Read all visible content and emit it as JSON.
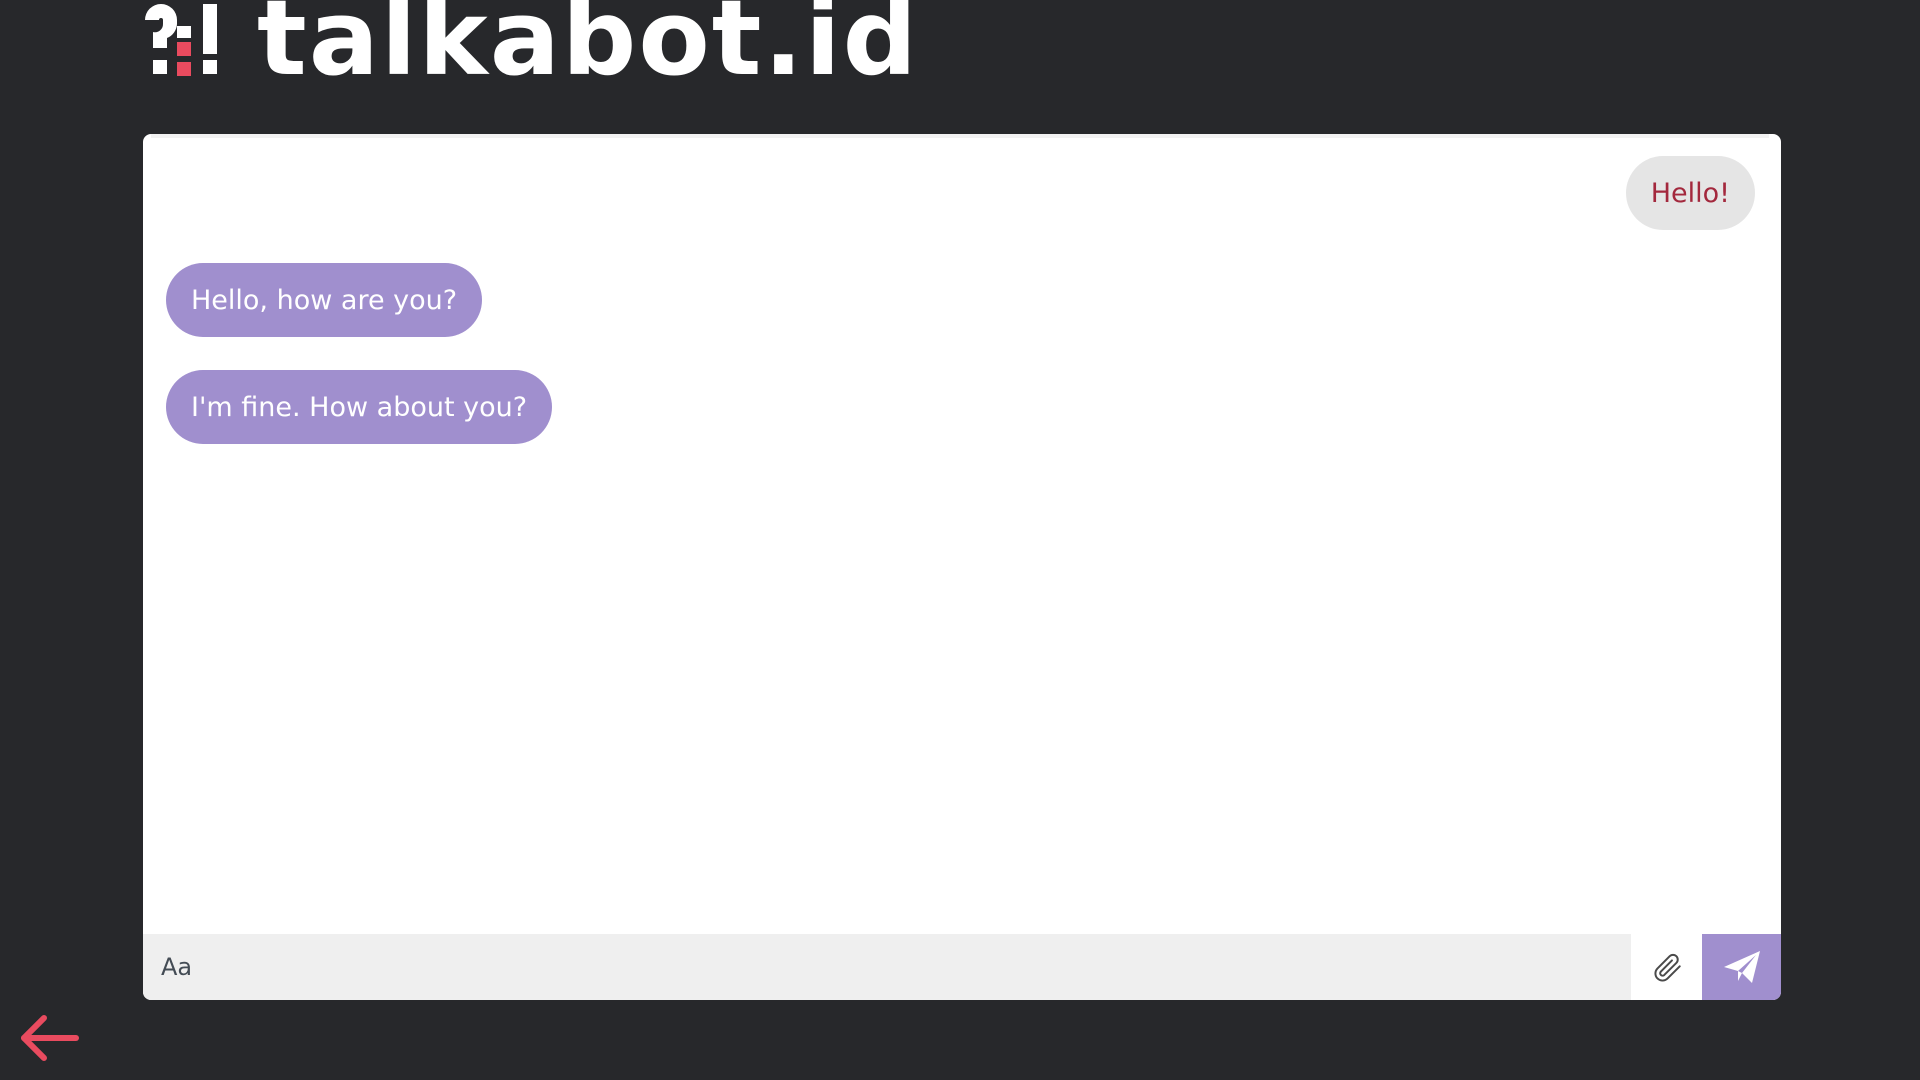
{
  "brand": {
    "name": "talkabot.id",
    "accent_color": "#e94b5f"
  },
  "colors": {
    "background": "#27282b",
    "bubble_received": "#a08fce",
    "bubble_sent": "#e5e5e5",
    "sent_text": "#a3283d",
    "send_button": "#a08fce"
  },
  "messages": [
    {
      "from": "user",
      "text": "Hello!"
    },
    {
      "from": "bot",
      "text": "Hello, how are you?"
    },
    {
      "from": "bot",
      "text": "I'm fine. How about you?"
    }
  ],
  "composer": {
    "placeholder": "Aa",
    "attach_icon": "paperclip-icon",
    "send_icon": "paper-plane-icon"
  },
  "navigation": {
    "back_icon": "arrow-left-icon"
  }
}
